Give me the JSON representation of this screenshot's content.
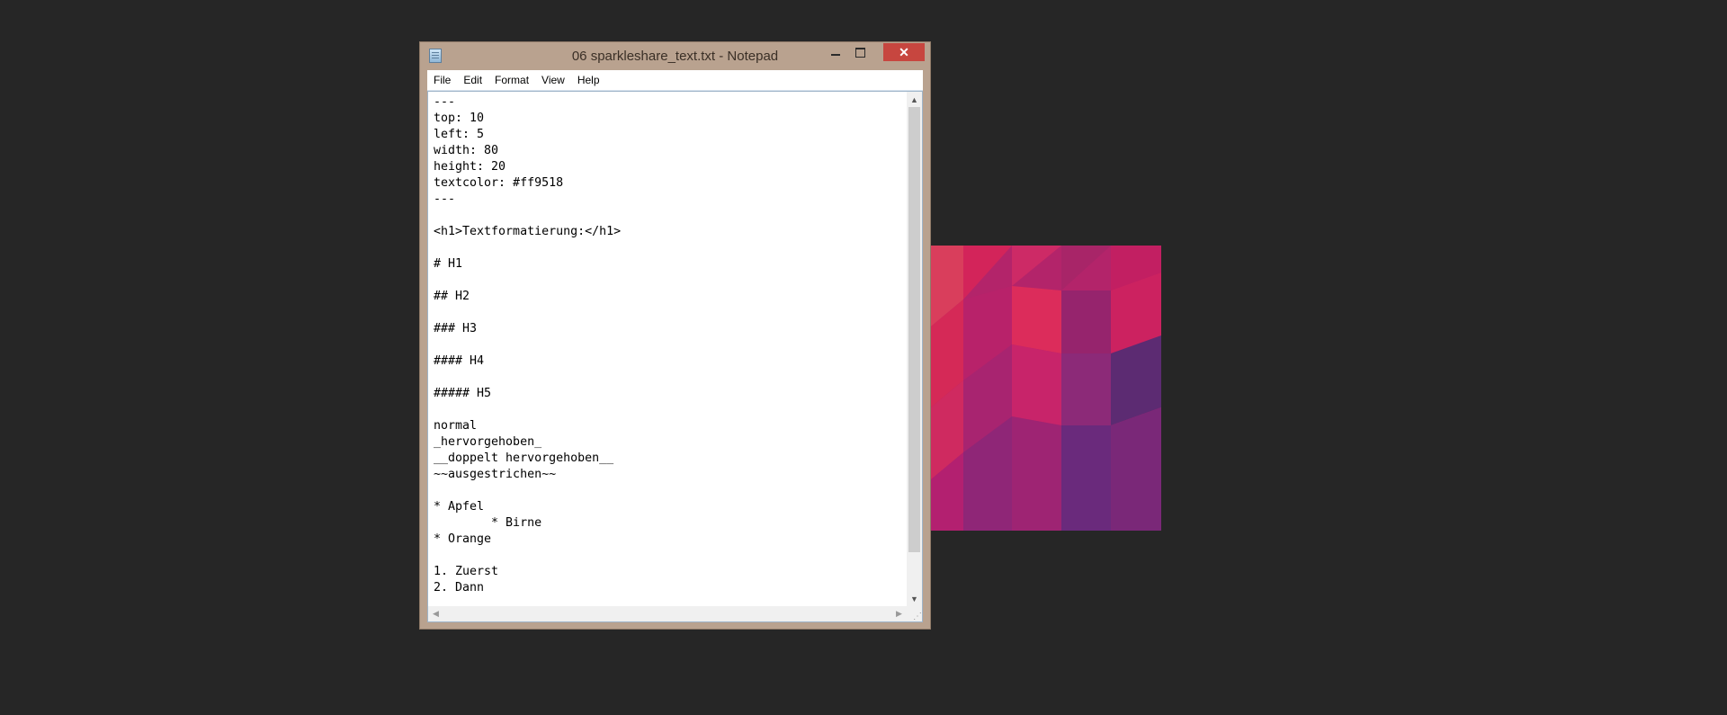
{
  "window": {
    "title": "06 sparkleshare_text.txt - Notepad",
    "icon": "notepad-icon",
    "controls": {
      "minimize_icon": "minimize-icon",
      "maximize_icon": "maximize-icon",
      "close_label": "✕"
    }
  },
  "menu": {
    "items": [
      "File",
      "Edit",
      "Format",
      "View",
      "Help"
    ]
  },
  "editor": {
    "content": "---\ntop: 10\nleft: 5\nwidth: 80\nheight: 20\ntextcolor: #ff9518\n---\n\n<h1>Textformatierung:</h1>\n\n# H1\n\n## H2\n\n### H3\n\n#### H4\n\n##### H5\n\nnormal\n_hervorgehoben_\n__doppelt hervorgehoben__\n~~ausgestrichen~~\n\n* Apfel\n        * Birne\n* Orange\n\n1. Zuerst\n2. Dann"
  },
  "scrollbars": {
    "up_arrow": "▲",
    "down_arrow": "▼",
    "left_arrow": "◀",
    "right_arrow": "▶"
  },
  "colors": {
    "desktop": "#262626",
    "window_frame": "#b9a28f",
    "close_button": "#c7463f"
  }
}
